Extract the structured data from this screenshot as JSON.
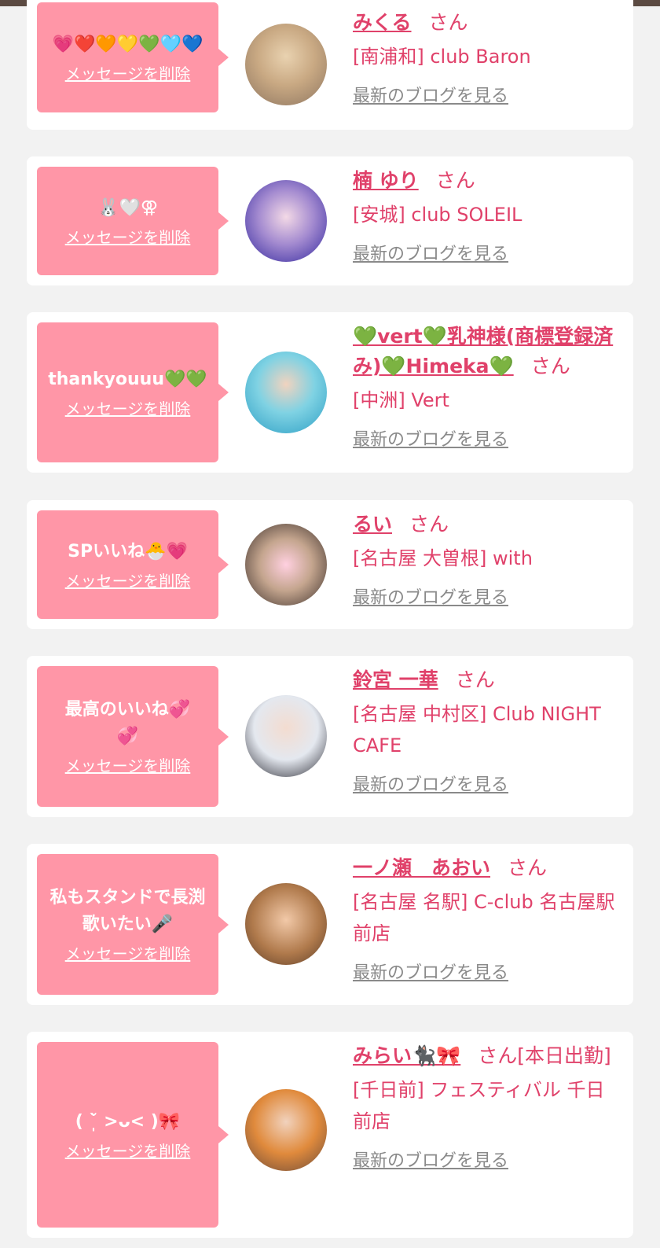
{
  "delete_label": "メッセージを削除",
  "blog_label": "最新のブログを見る",
  "san_label": "さん",
  "colors": {
    "bubble": "#ff96a7",
    "accent": "#e0416a",
    "link_gray": "#8a8a8a",
    "page_bg": "#f2f2f2"
  },
  "cards": [
    {
      "message": "💗❤️🧡💛💚🩵💙",
      "name": "みくる",
      "san": "さん",
      "shop": "[南浦和] club Baron",
      "avatar_icon": "avatar-photo-icon"
    },
    {
      "message": "🐰🤍⚢",
      "name": "楠 ゆり",
      "san": "さん",
      "shop": "[安城] club SOLEIL",
      "avatar_icon": "avatar-photo-icon"
    },
    {
      "message": "thankyouuu💚💚",
      "name": "💚vert💚乳神様(商標登録済み)💚Himeka💚",
      "san": "さん",
      "shop": "[中洲] Vert",
      "avatar_icon": "avatar-photo-icon"
    },
    {
      "message": "SPいいね🐣💗",
      "name": "るい",
      "san": "さん",
      "shop": "[名古屋 大曽根] with",
      "avatar_icon": "avatar-photo-icon"
    },
    {
      "message": "最高のいいね💞💞",
      "name": "鈴宮 一華",
      "san": "さん",
      "shop": "[名古屋 中村区] Club NIGHT CAFE",
      "avatar_icon": "avatar-photo-icon"
    },
    {
      "message": "私もスタンドで長渕歌いたい🎤",
      "name": "一ノ瀬　あおい",
      "san": "さん",
      "shop": "[名古屋 名駅] C-club 名古屋駅前店",
      "avatar_icon": "avatar-photo-icon"
    },
    {
      "message": "( ˘̩̀ >ᴗ< )🎀",
      "name": "みらい🐈‍⬛🎀",
      "san": "さん[本日出勤]",
      "shop": "[千日前] フェスティバル 千日前店",
      "avatar_icon": "avatar-photo-icon"
    }
  ]
}
